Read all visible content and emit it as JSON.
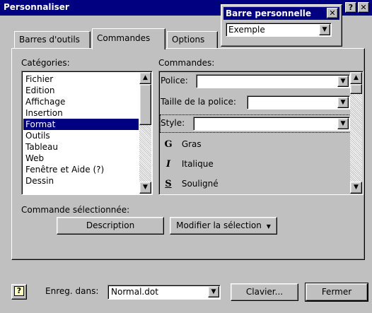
{
  "window": {
    "title": "Personnaliser",
    "help_glyph": "?",
    "close_glyph": "✕"
  },
  "toolbar_popup": {
    "title": "Barre personnelle",
    "close_glyph": "✕",
    "dropdown_value": "Exemple"
  },
  "tabs": [
    {
      "label": "Barres d'outils"
    },
    {
      "label": "Commandes"
    },
    {
      "label": "Options"
    }
  ],
  "categories": {
    "label": "Catégories:",
    "items": [
      "Fichier",
      "Edition",
      "Affichage",
      "Insertion",
      "Format",
      "Outils",
      "Tableau",
      "Web",
      "Fenêtre et Aide (?)",
      "Dessin"
    ],
    "selected": "Format"
  },
  "commands": {
    "label": "Commandes:",
    "police_label": "Police:",
    "taille_label": "Taille de la police:",
    "style_label": "Style:",
    "gras_label": "Gras",
    "gras_icon": "G",
    "italique_label": "Italique",
    "italique_icon": "I",
    "souligne_label": "Souligné",
    "souligne_icon": "S"
  },
  "selected_command": {
    "label": "Commande sélectionnée:",
    "description_button": "Description",
    "modify_button": "Modifier la sélection"
  },
  "footer": {
    "help_icon": "?",
    "save_in_label": "Enreg. dans:",
    "save_in_value": "Normal.dot",
    "keyboard_button": "Clavier...",
    "close_button": "Fermer"
  }
}
